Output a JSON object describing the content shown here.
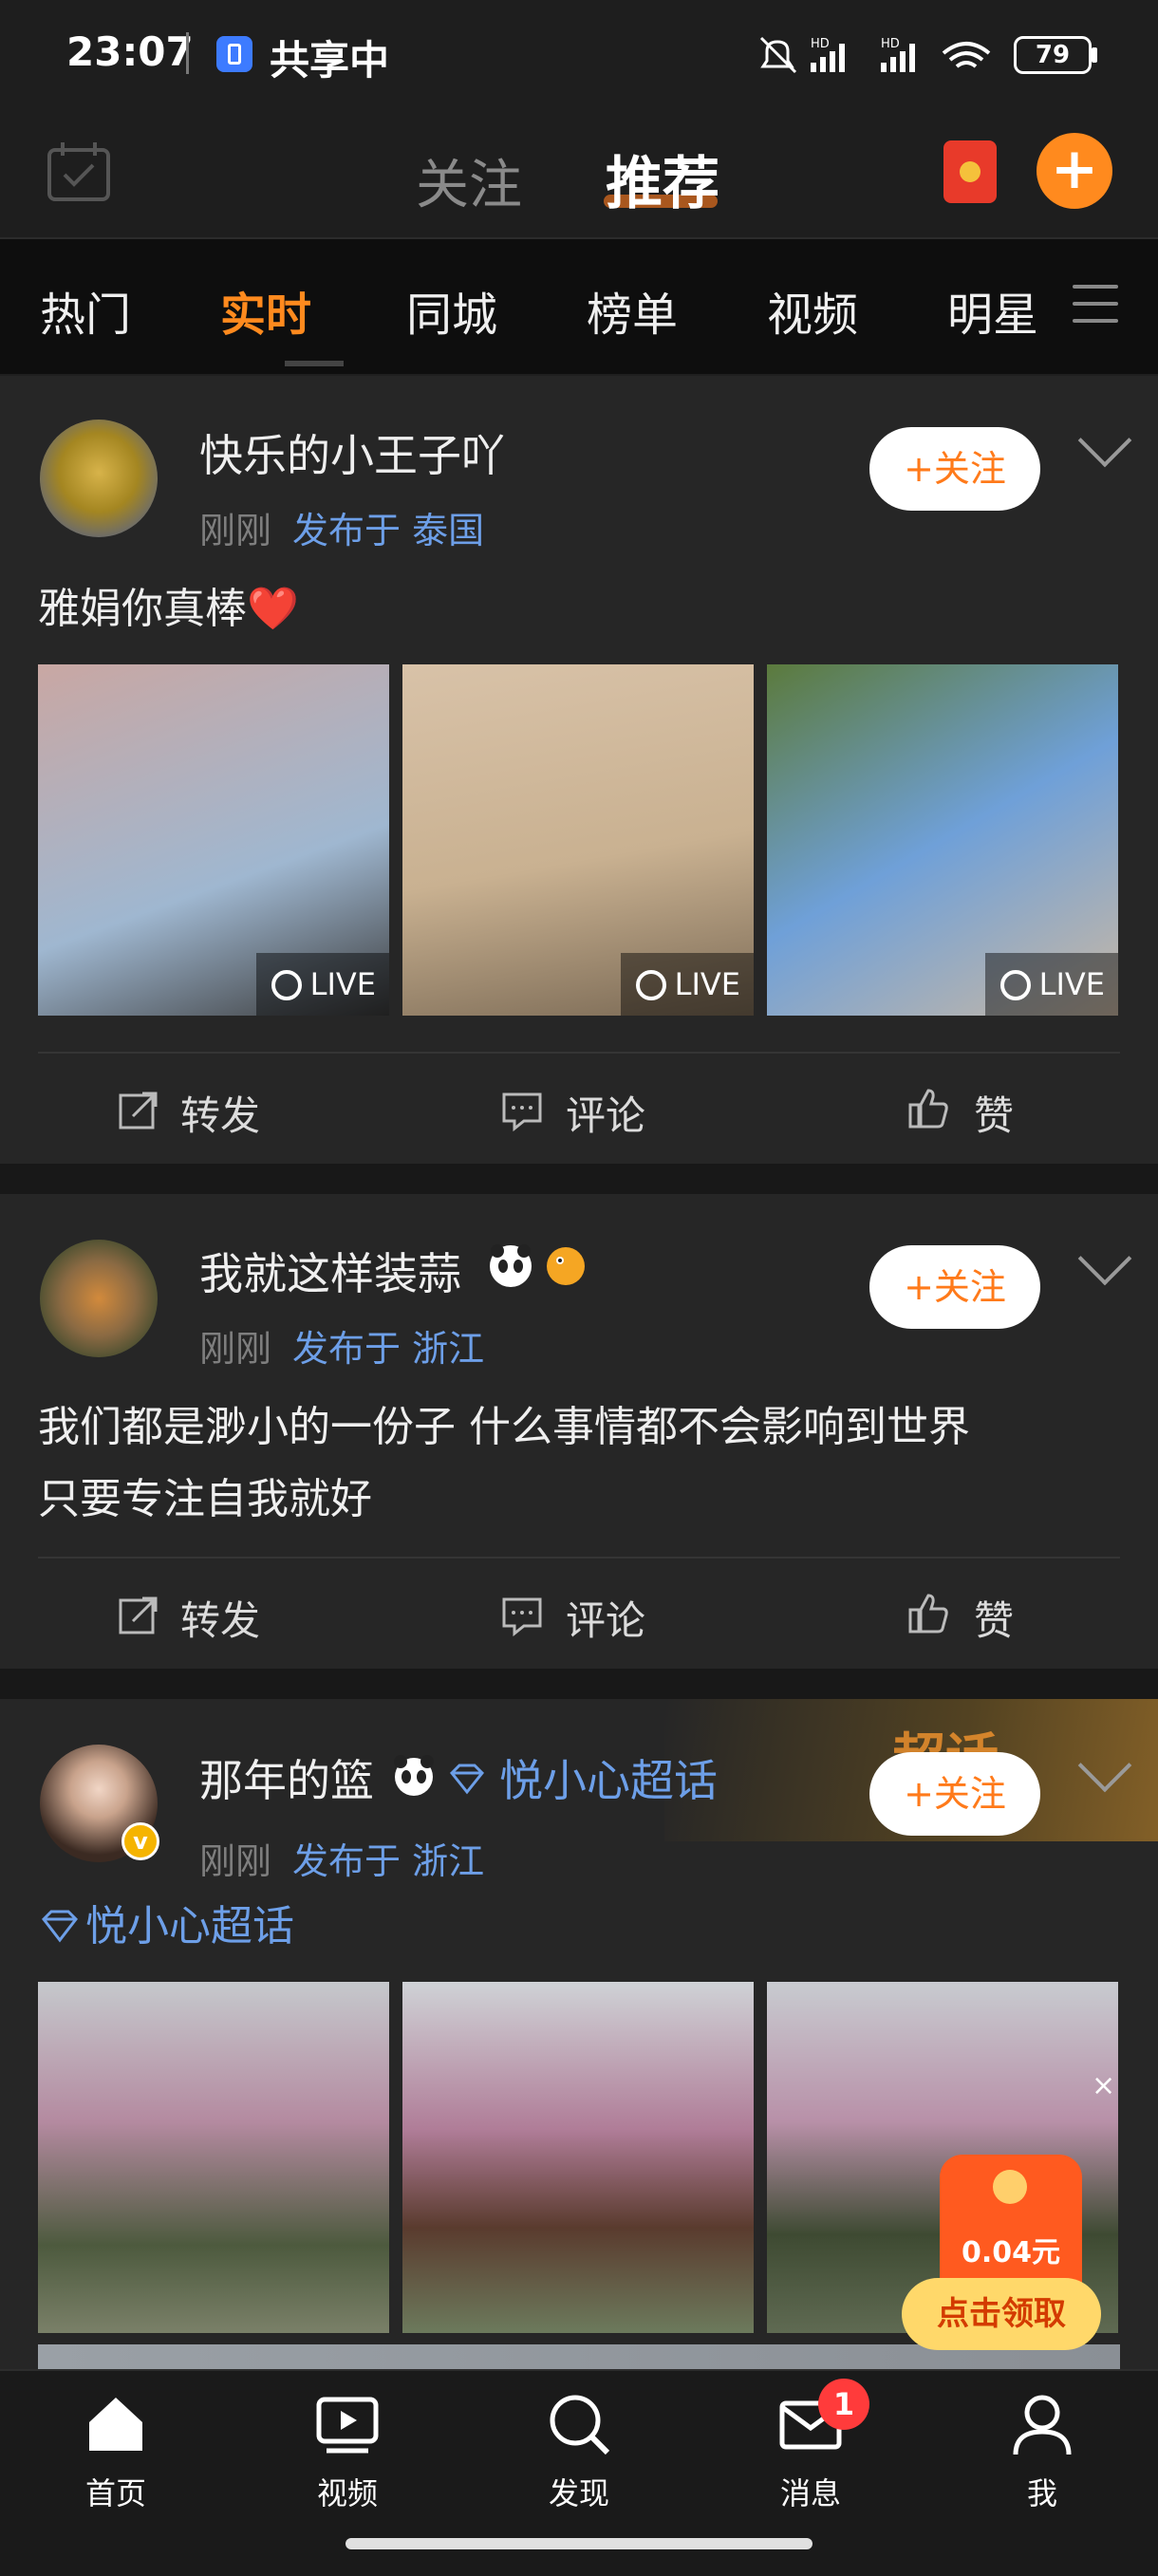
{
  "status_bar": {
    "time": "23:07",
    "sharing_label": "共享中",
    "battery": "79",
    "network_labels": [
      "HD",
      "HD"
    ]
  },
  "header": {
    "tabs": [
      "关注",
      "推荐"
    ],
    "active_tab": "推荐",
    "icons": [
      "calendar-check-icon",
      "red-packet-icon",
      "plus-icon"
    ]
  },
  "channels": {
    "items": [
      "热门",
      "实时",
      "同城",
      "榜单",
      "视频",
      "明星"
    ],
    "active": "实时"
  },
  "posts": [
    {
      "username": "快乐的小王子吖",
      "time": "刚刚",
      "location": "发布于 泰国",
      "follow_label": "+关注",
      "text": "雅娟你真棒❤️",
      "live_labels": [
        "LIVE",
        "LIVE",
        "LIVE"
      ],
      "actions": [
        "转发",
        "评论",
        "赞"
      ]
    },
    {
      "username": "我就这样装蒜",
      "time": "刚刚",
      "location": "发布于 浙江",
      "follow_label": "+关注",
      "text_lines": [
        "我们都是渺小的一份子 什么事情都不会影响到世界",
        "只要专注自我就好"
      ],
      "actions": [
        "转发",
        "评论",
        "赞"
      ]
    },
    {
      "username": "那年的篮",
      "supertopic": "悦小心超话",
      "time": "刚刚",
      "location": "发布于 浙江",
      "follow_label": "+关注",
      "topic_tag": "悦小心超话",
      "banner_text": "超话"
    }
  ],
  "coupon": {
    "amount": "0.04元",
    "claim_label": "点击领取",
    "close": "×"
  },
  "bottom_nav": {
    "items": [
      "首页",
      "视频",
      "发现",
      "消息",
      "我"
    ],
    "badge": "1"
  },
  "colors": {
    "accent": "#ff8a1e",
    "link": "#6d9fe8",
    "card_bg": "#262626"
  }
}
